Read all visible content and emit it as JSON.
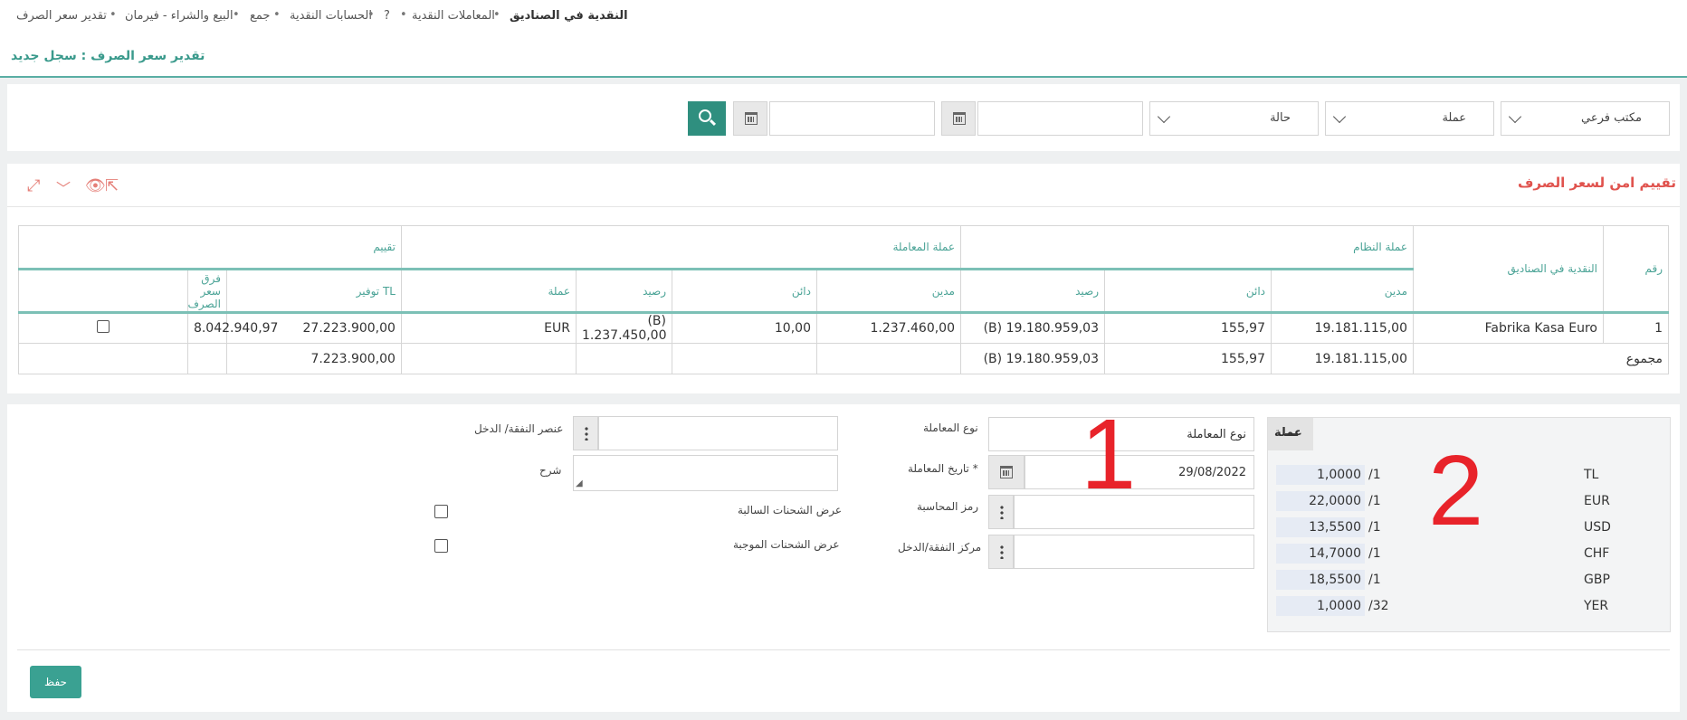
{
  "breadcrumb": {
    "items": [
      "النقدية في الصناديق",
      "المعاملات النقدية",
      "?",
      "الحسابات النقدية",
      "جمع",
      "البيع والشراء - فيرمان",
      "تقدير سعر الصرف"
    ]
  },
  "page_title": "تقدير سعر الصرف : سجل جديد",
  "filters": {
    "branch": "مكتب فرعي",
    "currency": "عملة",
    "status": "حالة",
    "date_from": "",
    "date_to": ""
  },
  "grid": {
    "title": "تقييم امن لسعر الصرف",
    "group_headers": {
      "number": "رقم",
      "cash_box": "النقدية في الصناديق",
      "system_currency": "عملة النظام",
      "transaction_currency": "عملة المعاملة",
      "evaluation": "تقييم"
    },
    "columns": {
      "debit": "مدين",
      "credit": "دائن",
      "balance": "رصيد",
      "currency": "عملة",
      "tl_saving": "TL توفير",
      "fx_diff": "فرق سعر الصرف"
    },
    "rows": [
      {
        "number": "1",
        "cash_box": "Fabrika Kasa Euro",
        "sys_debit": "19.181.115,00",
        "sys_credit": "155,97",
        "sys_balance": "(B) 19.180.959,03",
        "tx_debit": "1.237.460,00",
        "tx_credit": "10,00",
        "tx_balance": "(B) 1.237.450,00",
        "currency": "EUR",
        "tl_saving": "27.223.900,00",
        "fx_diff": "8.042.940,97"
      }
    ],
    "total": {
      "label": "مجموع",
      "sys_debit": "19.181.115,00",
      "sys_credit": "155,97",
      "sys_balance": "(B) 19.180.959,03",
      "tl_saving": "7.223.900,00"
    }
  },
  "form": {
    "transaction_type_label": "نوع المعاملة",
    "transaction_type_value": "نوع المعاملة",
    "transaction_date_label": "تاريخ المعاملة *",
    "transaction_date_value": "29/08/2022",
    "accounting_code_label": "رمز المحاسبة",
    "cost_center_label": "مركز النفقة/الدخل",
    "expense_item_label": "عنصر النفقة/ الدخل",
    "description_label": "شرح",
    "show_negative_label": "عرض الشحنات السالبة",
    "show_positive_label": "عرض الشحنات الموجبة"
  },
  "currency_box": {
    "title": "عملة",
    "rates": [
      {
        "code": "TL",
        "div": "/1",
        "rate": "1,0000"
      },
      {
        "code": "EUR",
        "div": "/1",
        "rate": "22,0000"
      },
      {
        "code": "USD",
        "div": "/1",
        "rate": "13,5500"
      },
      {
        "code": "CHF",
        "div": "/1",
        "rate": "14,7000"
      },
      {
        "code": "GBP",
        "div": "/1",
        "rate": "18,5500"
      },
      {
        "code": "YER",
        "div": "/32",
        "rate": "1,0000"
      }
    ]
  },
  "annotations": {
    "one": "1",
    "two": "2"
  },
  "save_label": "حفظ",
  "colors": {
    "accent": "#2f8f7f",
    "title_red": "#e0534e",
    "annotation_red": "#e8232a"
  }
}
